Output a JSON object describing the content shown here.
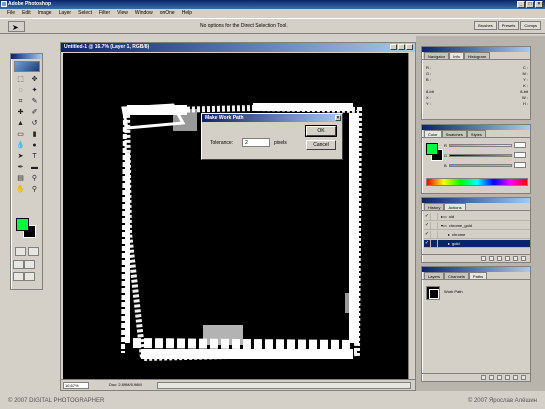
{
  "app": {
    "title": "Adobe Photoshop"
  },
  "menu": [
    "File",
    "Edit",
    "Image",
    "Layer",
    "Select",
    "Filter",
    "View",
    "Window",
    "onOne",
    "Help"
  ],
  "options_bar": {
    "hint": "No options for the Direct Selection Tool.",
    "palette_tabs": [
      "Brushes",
      "Presets",
      "Comps"
    ]
  },
  "document": {
    "title": "Untitled-1 @ 16.7% (Layer 1, RGB/8)",
    "zoom": "16.67%",
    "info": "Doc: 2.89M/5.96M"
  },
  "dialog": {
    "title": "Make Work Path",
    "tolerance_label": "Tolerance:",
    "tolerance_value": "2",
    "tolerance_unit": "pixels",
    "ok_label": "OK",
    "cancel_label": "Cancel"
  },
  "navigator_panel": {
    "tabs": [
      "Navigator",
      "Info",
      "Histogram"
    ],
    "active_tab": "Info",
    "rows": [
      {
        "left": "R :",
        "right": "C :"
      },
      {
        "left": "G :",
        "right": "M :"
      },
      {
        "left": "B :",
        "right": "Y :"
      },
      {
        "left": "",
        "right": "K :"
      },
      {
        "left": "8-bit",
        "right": "8-bit"
      },
      {
        "left": "X :",
        "right": "W :"
      },
      {
        "left": "Y :",
        "right": "H :"
      }
    ]
  },
  "color_panel": {
    "tabs": [
      "Color",
      "Swatches",
      "Styles"
    ],
    "channels": [
      "R",
      "G",
      "B"
    ],
    "colors": {
      "foreground": "#00ff40",
      "background": "#000000"
    }
  },
  "actions_panel": {
    "tabs": [
      "History",
      "Actions"
    ],
    "rows": [
      {
        "label": "old",
        "checked": true,
        "selected": false
      },
      {
        "label": "chrome_gold",
        "checked": true,
        "selected": false
      },
      {
        "label": "chrome",
        "checked": true,
        "selected": false
      },
      {
        "label": "gold",
        "checked": true,
        "selected": true
      }
    ]
  },
  "paths_panel": {
    "tabs": [
      "Layers",
      "Channels",
      "Paths"
    ],
    "active_tab": "Paths",
    "path_name": "Work Path"
  },
  "footer": {
    "left": "© 2007 DIGITAL PHOTOGRAPHER",
    "right": "© 2007 Ярослав Алёшин"
  }
}
